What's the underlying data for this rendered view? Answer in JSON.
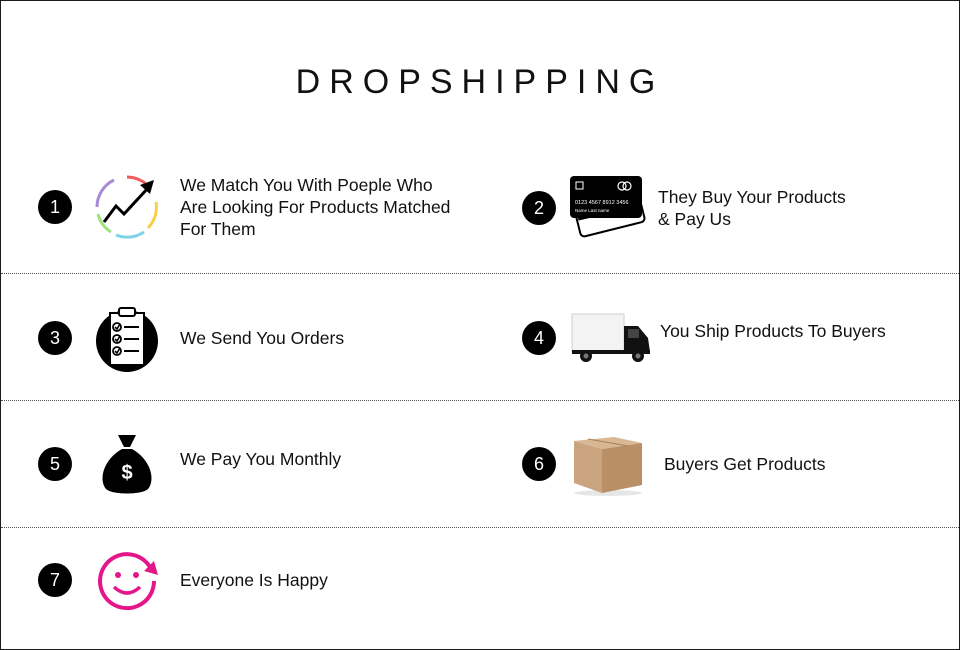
{
  "title": "DROPSHIPPING",
  "steps": [
    {
      "number": "1",
      "icon": "growth-chart-icon",
      "lines": [
        "We Match You With Poeple Who",
        "Are Looking For Products Matched",
        "For Them"
      ]
    },
    {
      "number": "2",
      "icon": "credit-card-icon",
      "card_number": "0123 4567 8912 3456",
      "card_name": "Name Last name",
      "lines": [
        "They Buy Your Products",
        "& Pay Us"
      ]
    },
    {
      "number": "3",
      "icon": "checklist-clipboard-icon",
      "lines": [
        "We Send You Orders"
      ]
    },
    {
      "number": "4",
      "icon": "delivery-truck-icon",
      "lines": [
        "You Ship Products To Buyers"
      ]
    },
    {
      "number": "5",
      "icon": "money-bag-icon",
      "lines": [
        "We Pay You Monthly"
      ]
    },
    {
      "number": "6",
      "icon": "cardboard-box-icon",
      "lines": [
        "Buyers Get Products"
      ]
    },
    {
      "number": "7",
      "icon": "happy-face-icon",
      "lines": [
        "Everyone Is Happy"
      ]
    }
  ],
  "colors": {
    "badge": "#000000",
    "happy_face": "#e5168a",
    "box": "#c9a47e"
  }
}
